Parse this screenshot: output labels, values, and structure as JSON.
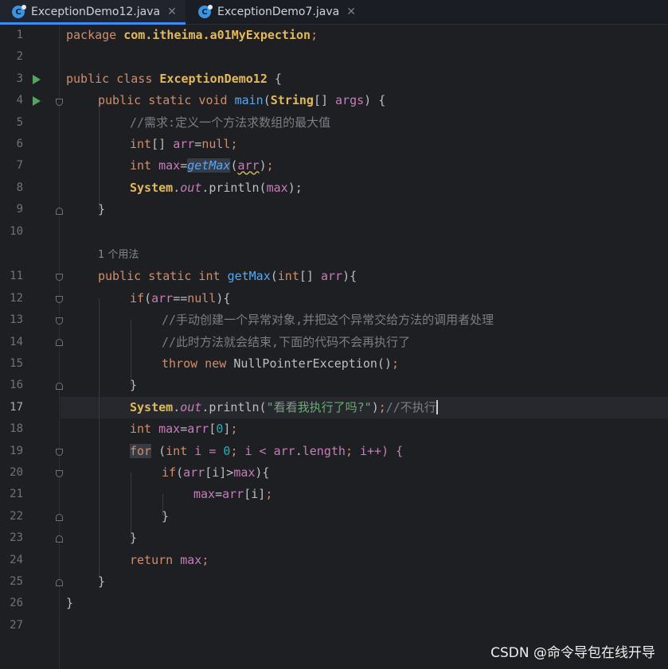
{
  "tabs": [
    {
      "label": "ExceptionDemo12.java",
      "icon": "java-class-icon",
      "active": true
    },
    {
      "label": "ExceptionDemo7.java",
      "icon": "java-class-icon",
      "active": false
    }
  ],
  "gutter": {
    "line_numbers": [
      "1",
      "2",
      "3",
      "4",
      "5",
      "6",
      "7",
      "8",
      "9",
      "10",
      "11",
      "12",
      "13",
      "14",
      "15",
      "16",
      "17",
      "18",
      "19",
      "20",
      "21",
      "22",
      "23",
      "24",
      "25",
      "26",
      "27"
    ],
    "current_line": "17"
  },
  "code": {
    "l1": {
      "kw": "package ",
      "pkg": "com.itheima.a01MyExpection",
      "semi": ";"
    },
    "l3": {
      "kw": "public class ",
      "cls": "ExceptionDemo12",
      "rest": " {"
    },
    "l4": {
      "kw": "public static void ",
      "fn": "main",
      "p1": "(",
      "cls": "String",
      "p2": "[] ",
      "var": "args",
      "rest": ") {"
    },
    "l5": {
      "cmt": "//需求:定义一个方法求数组的最大值"
    },
    "l6": {
      "kw": "int",
      "p1": "[] ",
      "warn": "arr",
      "p2": "=",
      "kw2": "null",
      "semi": ";"
    },
    "l7": {
      "kw": "int ",
      "var": "max",
      "p1": "=",
      "fn": "getMax",
      "p2": "(",
      "warn": "arr",
      "p3": ")",
      "semi": ";"
    },
    "l8": {
      "cls": "System",
      "dot1": ".",
      "fld": "out",
      "call": ".println(",
      "var": "max",
      "end": ");"
    },
    "l9": {
      "rest": "}"
    },
    "usages": "1 个用法",
    "l11": {
      "kw": "public static int ",
      "fn": "getMax",
      "p1": "(",
      "kw2": "int",
      "p2": "[] ",
      "var": "arr",
      "rest": "){"
    },
    "l12": {
      "kw": "if",
      "p1": "(",
      "var": "arr",
      "op": "==",
      "kw2": "null",
      "rest": "){"
    },
    "l13": {
      "cmt": "//手动创建一个异常对象,并把这个异常交给方法的调用者处理"
    },
    "l14": {
      "cmt": "//此时方法就会结束,下面的代码不会再执行了"
    },
    "l15": {
      "kw": "throw new ",
      "ident": "NullPointerException()",
      "semi": ";"
    },
    "l16": {
      "rest": "}"
    },
    "l17": {
      "cls": "System",
      "dot1": ".",
      "fld": "out",
      "call": ".println(",
      "str": "\"看看我执行了吗?\"",
      "end": ")",
      "semi": ";",
      "cmt": "//不执行"
    },
    "l18": {
      "kw": "int ",
      "var": "max",
      "p1": "=",
      "var2": "arr",
      "p2": "[",
      "num": "0",
      "p3": "]",
      "semi": ";"
    },
    "l19": {
      "kw": "for",
      "p1": " (",
      "kw2": "int ",
      "ident": "i = ",
      "num": "0",
      "semi1": "; ",
      "ident2": "i < ",
      "var": "arr",
      "dot": ".",
      "fld": "length",
      "semi2": "; ",
      "ident3": "i++) {"
    },
    "l20": {
      "kw": "if",
      "p1": "(",
      "var": "arr",
      "p2": "[i]>",
      "var2": "max",
      "rest": "){"
    },
    "l21": {
      "var": "max",
      "p1": "=",
      "var2": "arr",
      "p2": "[i]",
      "semi": ";"
    },
    "l22": {
      "rest": "}"
    },
    "l23": {
      "rest": "}"
    },
    "l24": {
      "kw": "return ",
      "var": "max",
      "semi": ";"
    },
    "l25": {
      "rest": "}"
    },
    "l26": {
      "rest": "}"
    }
  },
  "watermark": "CSDN @命令导包在线开导",
  "colors": {
    "background": "#1e1f22",
    "keyword": "#cf8e6d",
    "class": "#e3b95b",
    "method": "#56a8f5",
    "variable": "#c77dbb",
    "string": "#6aab73",
    "comment": "#7a7e85",
    "number": "#2aacb8",
    "run_icon": "#4ca85b"
  }
}
